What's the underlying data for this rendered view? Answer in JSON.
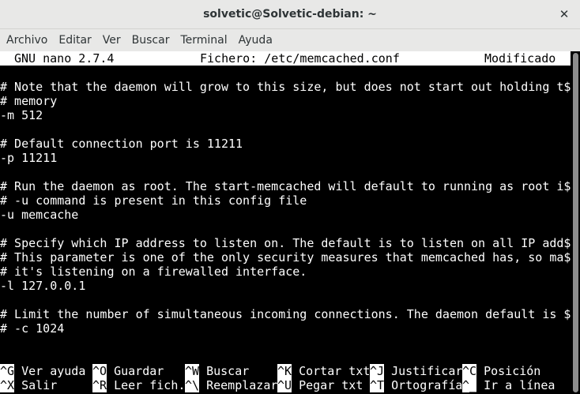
{
  "window": {
    "title": "solvetic@Solvetic-debian: ~",
    "close_glyph": "✕"
  },
  "menubar": {
    "items": [
      "Archivo",
      "Editar",
      "Ver",
      "Buscar",
      "Terminal",
      "Ayuda"
    ]
  },
  "nano": {
    "version": "GNU nano 2.7.4",
    "file": "Fichero: /etc/memcached.conf",
    "status": "Modificado",
    "lines": [
      "",
      "# Note that the daemon will grow to this size, but does not start out holding t$",
      "# memory",
      "-m 512",
      "",
      "# Default connection port is 11211",
      "-p 11211",
      "",
      "# Run the daemon as root. The start-memcached will default to running as root i$",
      "# -u command is present in this config file",
      "-u memcache",
      "",
      "# Specify which IP address to listen on. The default is to listen on all IP add$",
      "# This parameter is one of the only security measures that memcached has, so ma$",
      "# it's listening on a firewalled interface.",
      "-l 127.0.0.1",
      "",
      "# Limit the number of simultaneous incoming connections. The daemon default is $",
      "# -c 1024"
    ],
    "shortcuts_row1": [
      {
        "key": "^G",
        "label": "Ver ayuda"
      },
      {
        "key": "^O",
        "label": "Guardar"
      },
      {
        "key": "^W",
        "label": "Buscar"
      },
      {
        "key": "^K",
        "label": "Cortar txt"
      },
      {
        "key": "^J",
        "label": "Justificar"
      },
      {
        "key": "^C",
        "label": "Posición"
      }
    ],
    "shortcuts_row2": [
      {
        "key": "^X",
        "label": "Salir"
      },
      {
        "key": "^R",
        "label": "Leer fich."
      },
      {
        "key": "^\\",
        "label": "Reemplazar"
      },
      {
        "key": "^U",
        "label": "Pegar txt"
      },
      {
        "key": "^T",
        "label": "Ortografía"
      },
      {
        "key": "^_",
        "label": "Ir a línea"
      }
    ]
  }
}
